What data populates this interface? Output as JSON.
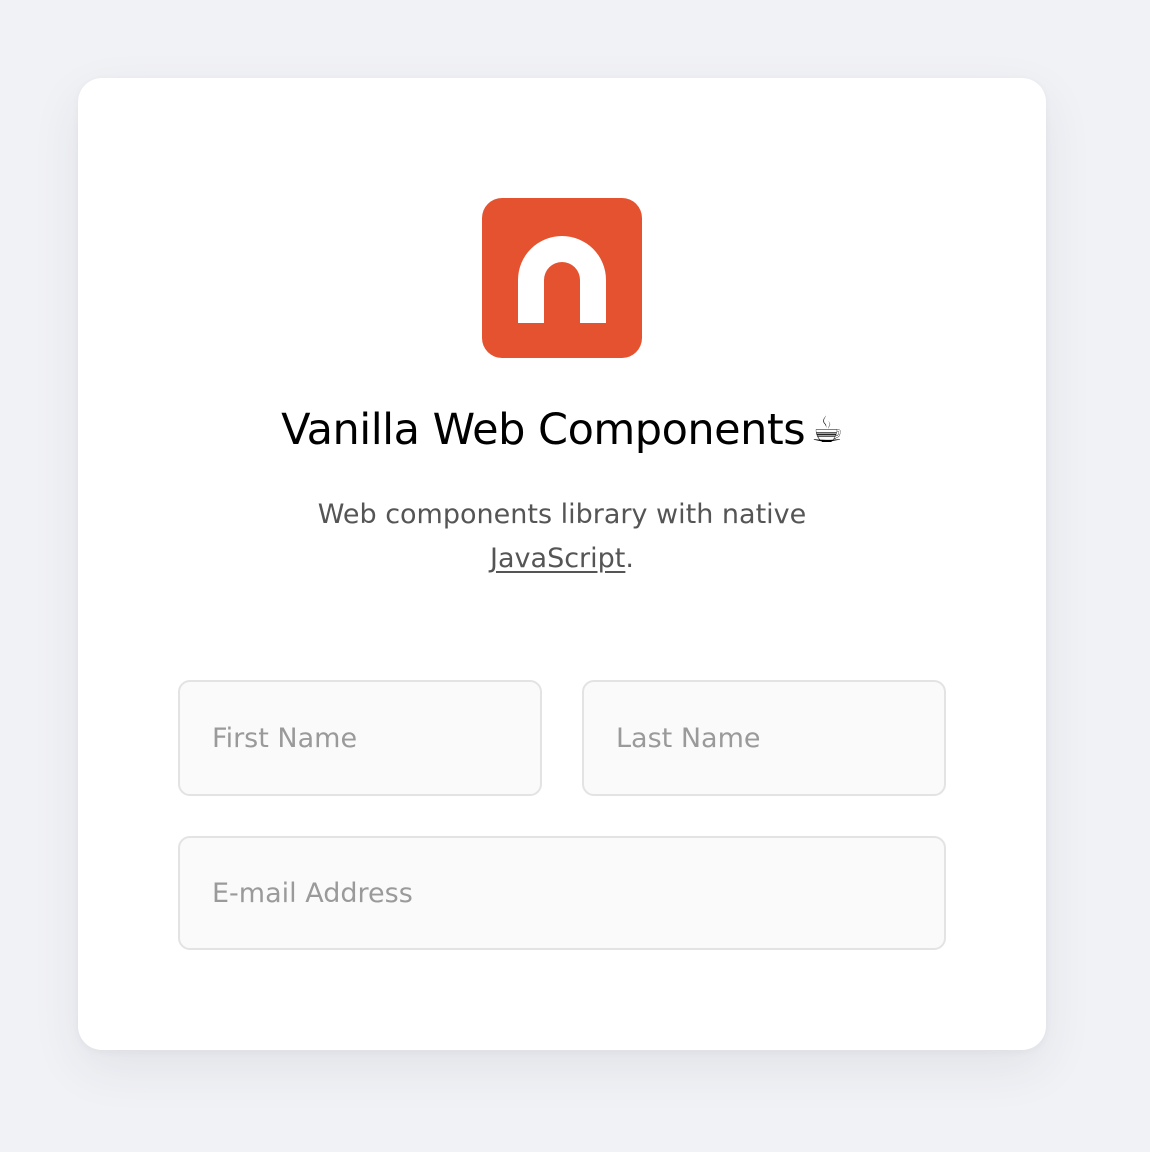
{
  "brand": {
    "logo_icon": "n-arch-logo",
    "logo_color": "#e5522f"
  },
  "header": {
    "title": "Vanilla Web Components",
    "title_emoji": "☕"
  },
  "description": {
    "text_before_link": "Web components library with native ",
    "link_text": "JavaScript",
    "text_after_link": "."
  },
  "form": {
    "first_name": {
      "placeholder": "First Name",
      "value": ""
    },
    "last_name": {
      "placeholder": "Last Name",
      "value": ""
    },
    "email": {
      "placeholder": "E-mail Address",
      "value": ""
    }
  }
}
